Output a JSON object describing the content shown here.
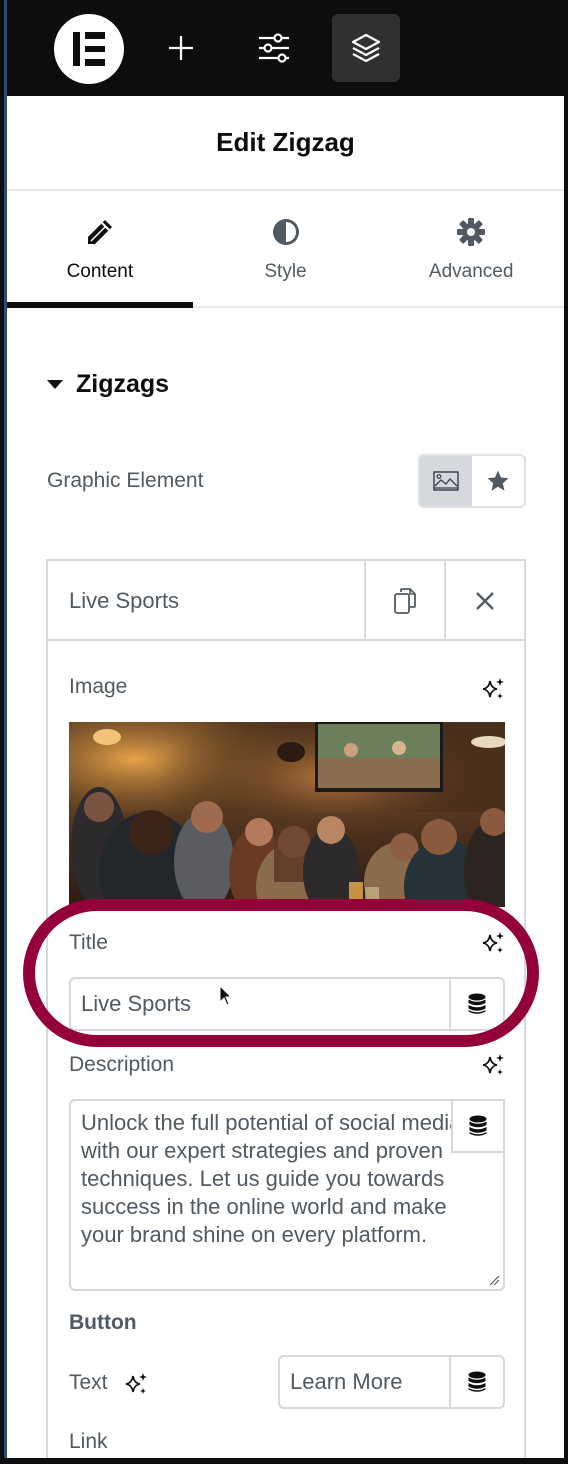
{
  "topbar": {
    "logo": "elementor-logo",
    "buttons": [
      {
        "name": "add-element",
        "icon": "plus-icon"
      },
      {
        "name": "site-settings",
        "icon": "sliders-icon"
      },
      {
        "name": "structure",
        "icon": "layers-icon",
        "active": true
      }
    ]
  },
  "header": {
    "title": "Edit Zigzag"
  },
  "tabs": [
    {
      "label": "Content",
      "icon": "pencil-icon",
      "active": true
    },
    {
      "label": "Style",
      "icon": "half-circle-icon",
      "active": false
    },
    {
      "label": "Advanced",
      "icon": "gear-icon",
      "active": false
    }
  ],
  "section": {
    "title": "Zigzags",
    "graphic_element": {
      "label": "Graphic Element",
      "options": [
        "image",
        "icon"
      ],
      "selected": "image"
    }
  },
  "item": {
    "title": "Live Sports",
    "actions": [
      "duplicate",
      "remove"
    ],
    "fields": {
      "image_label": "Image",
      "image_alt": "People cheering in a pub watching sports on a wall-mounted TV",
      "title_label": "Title",
      "title_value": "Live Sports",
      "description_label": "Description",
      "description_value": "Unlock the full potential of social media with our expert strategies and proven techniques. Let us guide you towards success in the online world and make your brand shine on every platform.",
      "button_heading": "Button",
      "button_text_label": "Text",
      "button_text_value": "Learn More",
      "link_label": "Link"
    }
  },
  "annotation": {
    "color": "#93003a",
    "target": "title-field"
  },
  "colors": {
    "accent": "#0c0d0e",
    "text": "#515962",
    "border": "#d5d8dc"
  }
}
